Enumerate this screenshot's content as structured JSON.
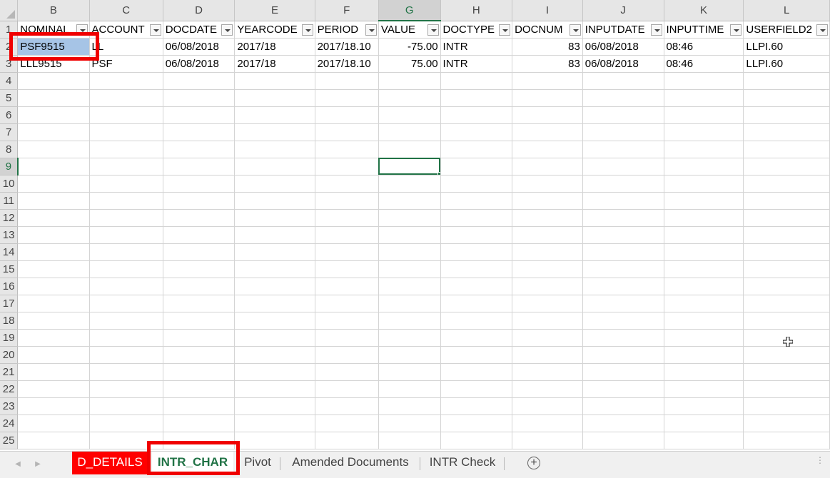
{
  "columns": [
    "B",
    "C",
    "D",
    "E",
    "F",
    "G",
    "H",
    "I",
    "J",
    "K",
    "L"
  ],
  "row_numbers": [
    "1",
    "2",
    "3",
    "4",
    "5",
    "6",
    "7",
    "8",
    "9",
    "10",
    "11",
    "12",
    "13",
    "14",
    "15",
    "16",
    "17",
    "18",
    "19",
    "20",
    "21",
    "22",
    "23",
    "24",
    "25"
  ],
  "headers": [
    "NOMINAL",
    "ACCOUNT",
    "DOCDATE",
    "YEARCODE",
    "PERIOD",
    "VALUE",
    "DOCTYPE",
    "DOCNUM",
    "INPUTDATE",
    "INPUTTIME",
    "USERFIELD2"
  ],
  "rows": [
    [
      "PSF9515",
      "LL",
      "06/08/2018",
      "2017/18",
      "2017/18.10",
      "-75.00",
      "INTR",
      "83",
      "06/08/2018",
      "08:46",
      "LLPI.60"
    ],
    [
      "LLL9515",
      "PSF",
      "06/08/2018",
      "2017/18",
      "2017/18.10",
      "75.00",
      "INTR",
      "83",
      "06/08/2018",
      "08:46",
      "LLPI.60"
    ]
  ],
  "active_cell": "G9",
  "sheet_tabs": {
    "d_details": "D_DETAILS",
    "intr_char": "INTR_CHAR",
    "pivot": "Pivot",
    "amended": "Amended Documents",
    "intr_check": "INTR Check"
  },
  "colors": {
    "excel_green": "#217346",
    "highlight_red": "#f00000",
    "selection_blue": "#a6c4e6"
  },
  "icons": {
    "add_sheet": "plus-circle-icon",
    "cursor": "crosshair-cursor-icon"
  }
}
